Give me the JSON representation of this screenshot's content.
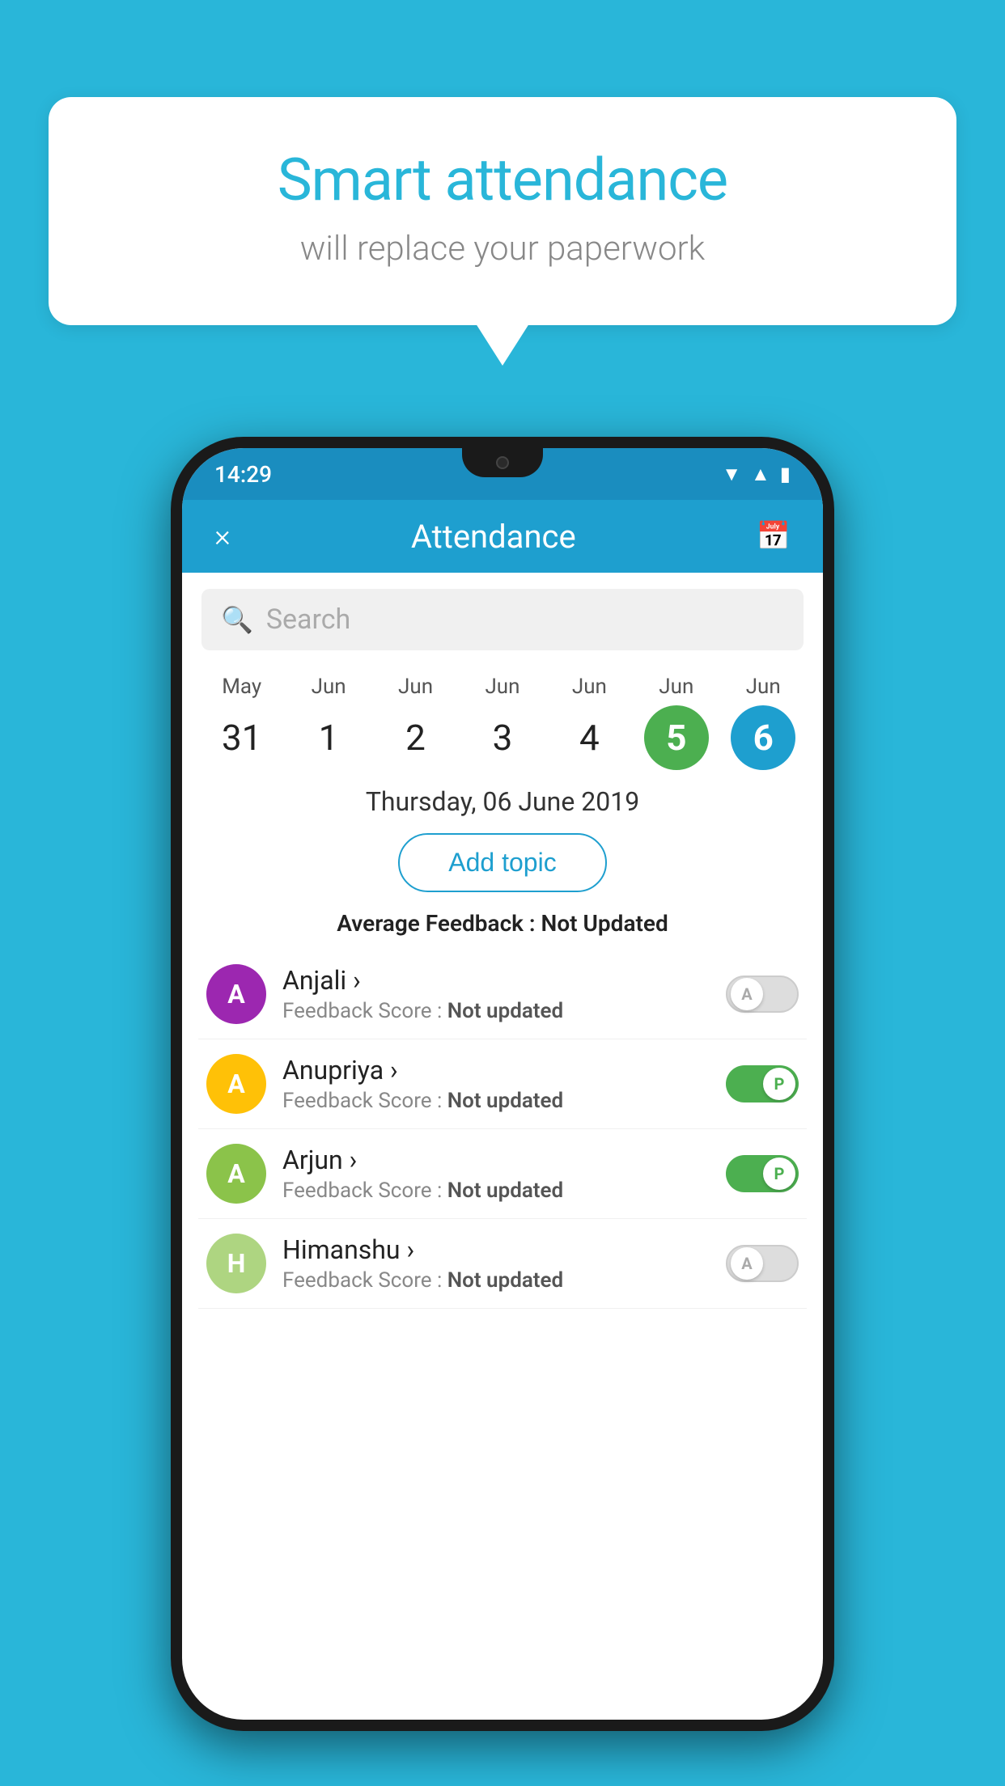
{
  "background_color": "#29b6d9",
  "speech_bubble": {
    "title": "Smart attendance",
    "subtitle": "will replace your paperwork"
  },
  "status_bar": {
    "time": "14:29",
    "icons": [
      "wifi",
      "signal",
      "battery"
    ]
  },
  "app_header": {
    "title": "Attendance",
    "close_label": "×",
    "calendar_icon": "📅"
  },
  "search": {
    "placeholder": "Search"
  },
  "calendar": {
    "days": [
      {
        "month": "May",
        "date": "31",
        "state": "normal"
      },
      {
        "month": "Jun",
        "date": "1",
        "state": "normal"
      },
      {
        "month": "Jun",
        "date": "2",
        "state": "normal"
      },
      {
        "month": "Jun",
        "date": "3",
        "state": "normal"
      },
      {
        "month": "Jun",
        "date": "4",
        "state": "normal"
      },
      {
        "month": "Jun",
        "date": "5",
        "state": "today"
      },
      {
        "month": "Jun",
        "date": "6",
        "state": "selected"
      }
    ]
  },
  "selected_date_label": "Thursday, 06 June 2019",
  "add_topic_label": "Add topic",
  "average_feedback": {
    "label": "Average Feedback : ",
    "value": "Not Updated"
  },
  "students": [
    {
      "name": "Anjali",
      "avatar_letter": "A",
      "avatar_color": "#9c27b0",
      "feedback_label": "Feedback Score : ",
      "feedback_value": "Not updated",
      "attendance": "absent"
    },
    {
      "name": "Anupriya",
      "avatar_letter": "A",
      "avatar_color": "#ffc107",
      "feedback_label": "Feedback Score : ",
      "feedback_value": "Not updated",
      "attendance": "present"
    },
    {
      "name": "Arjun",
      "avatar_letter": "A",
      "avatar_color": "#8bc34a",
      "feedback_label": "Feedback Score : ",
      "feedback_value": "Not updated",
      "attendance": "present"
    },
    {
      "name": "Himanshu",
      "avatar_letter": "H",
      "avatar_color": "#aed581",
      "feedback_label": "Feedback Score : ",
      "feedback_value": "Not updated",
      "attendance": "absent"
    }
  ]
}
